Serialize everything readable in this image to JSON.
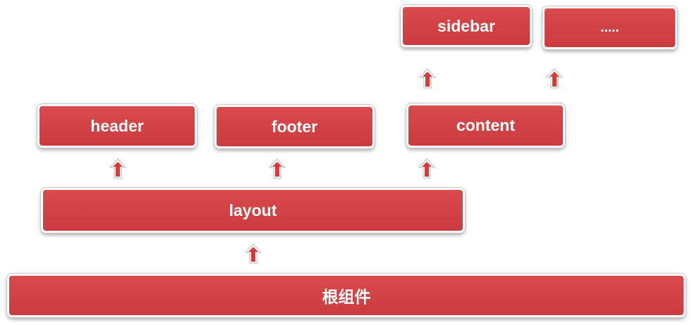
{
  "colors": {
    "box_fill": "#d3444a",
    "arrow_fill": "#d8393b"
  },
  "nodes": {
    "sidebar": "sidebar",
    "more": ".....",
    "header": "header",
    "footer": "footer",
    "content": "content",
    "layout": "layout",
    "root": "根组件"
  },
  "icons": {
    "arrow": "arrow-up-icon"
  }
}
